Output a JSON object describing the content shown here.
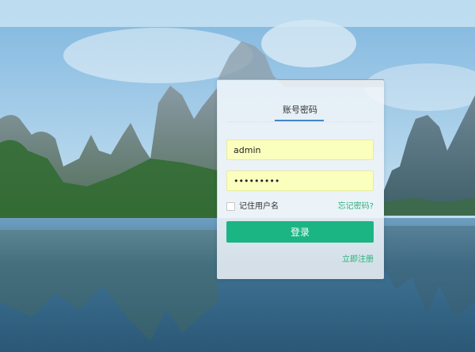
{
  "login": {
    "tab_label": "账号密码",
    "username_value": "admin",
    "password_value": "•••••••••",
    "remember_label": "记住用户名",
    "forgot_label": "忘记密码?",
    "submit_label": "登录",
    "register_label": "立即注册"
  }
}
